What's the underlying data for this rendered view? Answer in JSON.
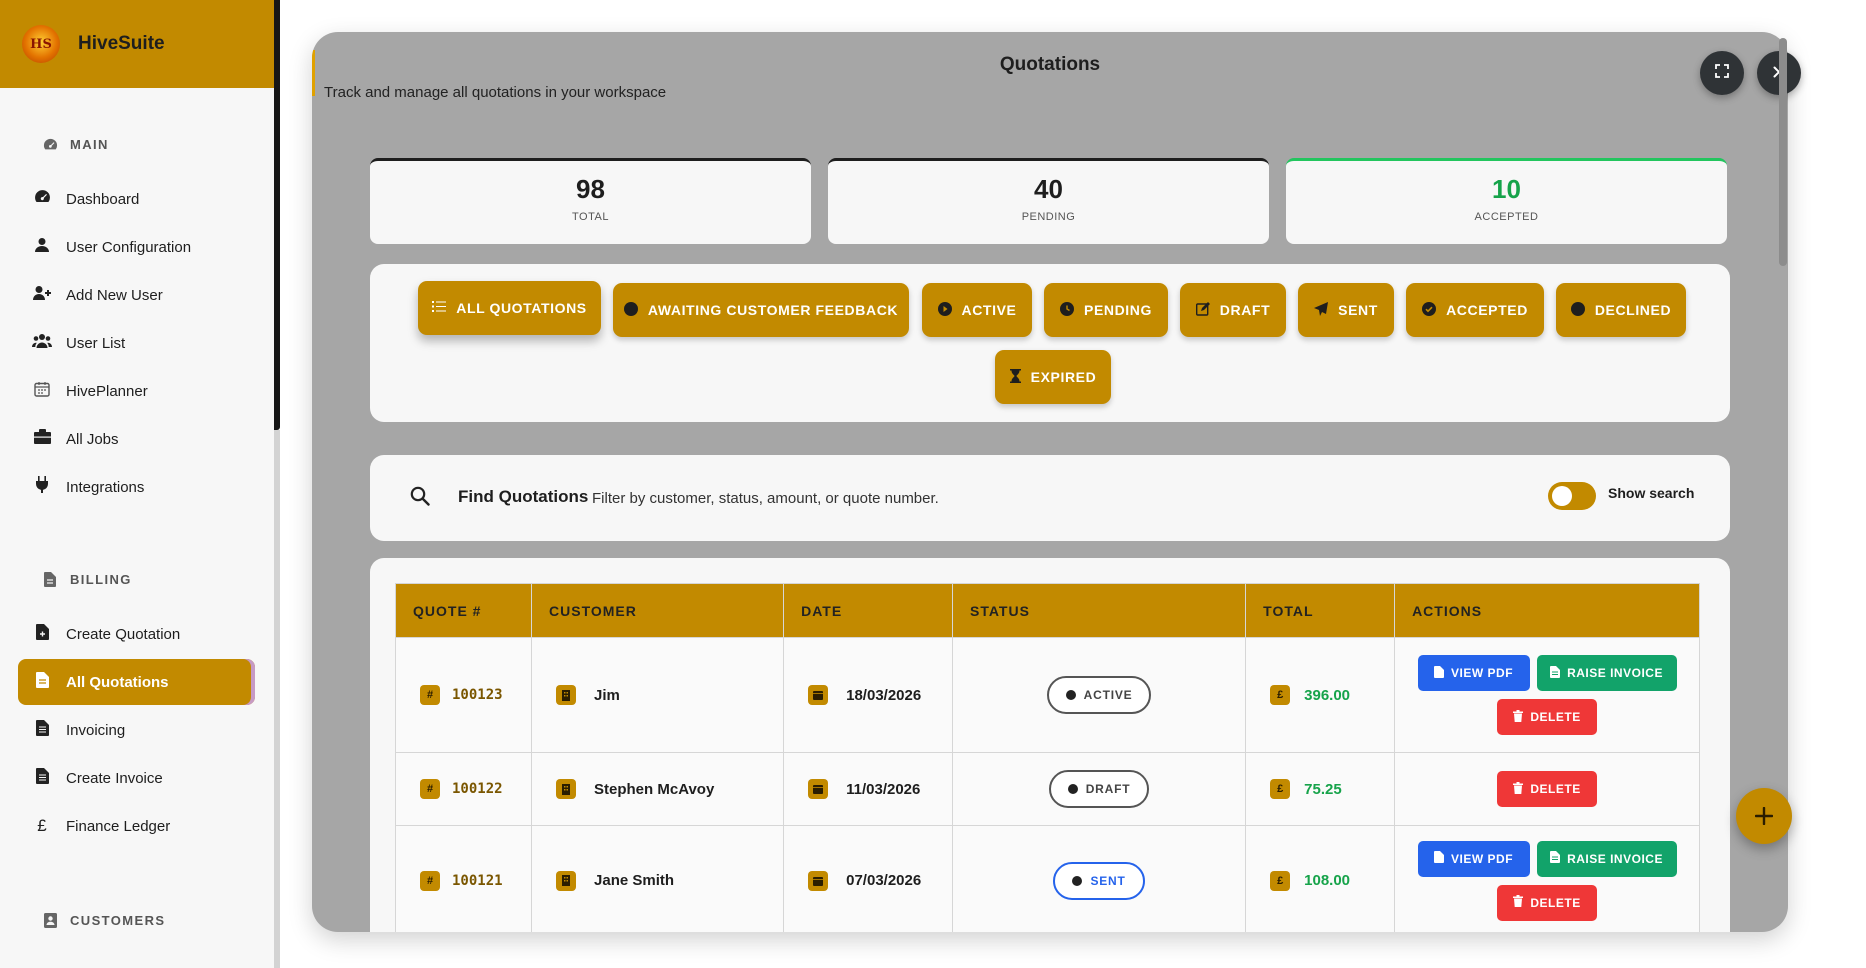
{
  "app": {
    "name": "HiveSuite",
    "logo_text": "HS"
  },
  "sidebar": {
    "sections": [
      {
        "title": "MAIN",
        "icon": "gauge-icon"
      },
      {
        "title": "BILLING",
        "icon": "document-icon"
      },
      {
        "title": "CUSTOMERS",
        "icon": "id-card-icon"
      }
    ],
    "items": [
      {
        "label": "Dashboard",
        "icon": "gauge-icon"
      },
      {
        "label": "User Configuration",
        "icon": "user-icon"
      },
      {
        "label": "Add New User",
        "icon": "user-plus-icon"
      },
      {
        "label": "User List",
        "icon": "users-icon"
      },
      {
        "label": "HivePlanner",
        "icon": "calendar-icon"
      },
      {
        "label": "All Jobs",
        "icon": "briefcase-icon"
      },
      {
        "label": "Integrations",
        "icon": "plug-icon"
      },
      {
        "label": "Create Quotation",
        "icon": "file-plus-icon"
      },
      {
        "label": "All Quotations",
        "icon": "file-icon",
        "active": true
      },
      {
        "label": "Invoicing",
        "icon": "file-invoice-icon"
      },
      {
        "label": "Create Invoice",
        "icon": "file-invoice-icon"
      },
      {
        "label": "Finance Ledger",
        "icon": "pound-icon"
      }
    ]
  },
  "modal": {
    "title": "Quotations",
    "subtitle": "Track and manage all quotations in your workspace",
    "fullscreen_icon": "expand-icon",
    "close_icon": "close-icon"
  },
  "stats": [
    {
      "value": "98",
      "label": "TOTAL"
    },
    {
      "value": "40",
      "label": "PENDING"
    },
    {
      "value": "10",
      "label": "ACCEPTED",
      "color": "#16a34a"
    }
  ],
  "filters": [
    {
      "label": "ALL QUOTATIONS",
      "icon": "list-icon"
    },
    {
      "label": "AWAITING CUSTOMER FEEDBACK",
      "icon": "circle-icon"
    },
    {
      "label": "ACTIVE",
      "icon": "play-circle-icon"
    },
    {
      "label": "PENDING",
      "icon": "clock-icon"
    },
    {
      "label": "DRAFT",
      "icon": "edit-icon"
    },
    {
      "label": "SENT",
      "icon": "paper-plane-icon"
    },
    {
      "label": "ACCEPTED",
      "icon": "check-circle-icon"
    },
    {
      "label": "DECLINED",
      "icon": "circle-icon"
    },
    {
      "label": "EXPIRED",
      "icon": "hourglass-icon"
    }
  ],
  "search": {
    "title": "Find Quotations",
    "description": "Filter by customer, status, amount, or quote number.",
    "toggle_label": "Show search",
    "toggle_on": false
  },
  "table": {
    "columns": [
      "QUOTE #",
      "CUSTOMER",
      "DATE",
      "STATUS",
      "TOTAL",
      "ACTIONS"
    ],
    "rows": [
      {
        "quote": "100123",
        "customer": "Jim",
        "date": "18/03/2026",
        "status": "ACTIVE",
        "total": "396.00",
        "actions": [
          "VIEW PDF",
          "RAISE INVOICE",
          "DELETE"
        ]
      },
      {
        "quote": "100122",
        "customer": "Stephen McAvoy",
        "date": "11/03/2026",
        "status": "DRAFT",
        "total": "75.25",
        "actions": [
          "DELETE"
        ]
      },
      {
        "quote": "100121",
        "customer": "Jane Smith",
        "date": "07/03/2026",
        "status": "SENT",
        "total": "108.00",
        "actions": [
          "VIEW PDF",
          "RAISE INVOICE",
          "DELETE"
        ]
      }
    ]
  },
  "colors": {
    "accent": "#c28a00",
    "success": "#16a34a",
    "primary": "#2563eb",
    "danger": "#ef3737"
  },
  "fab": {
    "icon": "plus-icon"
  }
}
